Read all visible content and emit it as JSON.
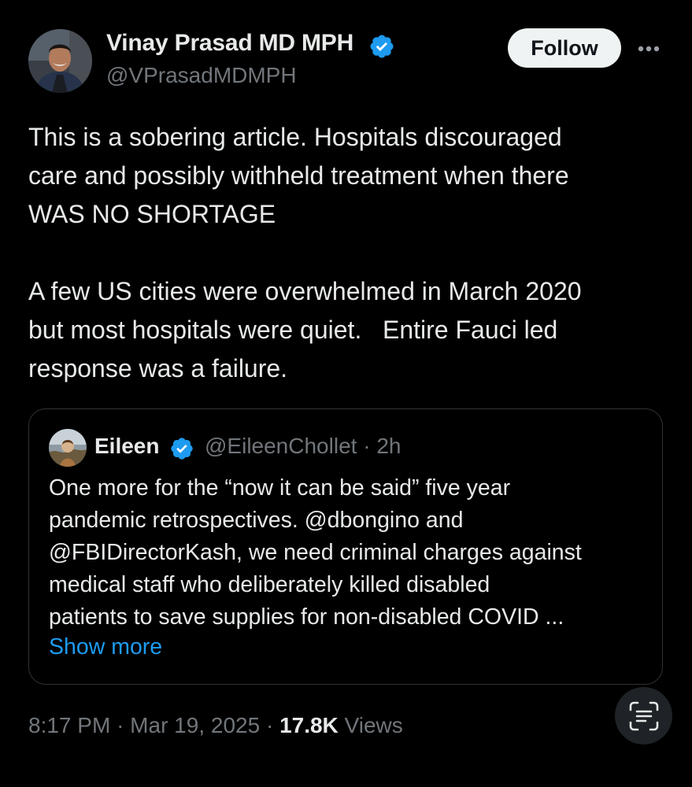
{
  "author": {
    "name": "Vinay Prasad MD MPH",
    "handle": "@VPrasadMDMPH",
    "avatar_icon": "profile-photo",
    "verified": true
  },
  "actions": {
    "follow_label": "Follow",
    "more_icon": "more-horizontal-icon"
  },
  "tweet": {
    "text": "This is a sobering article. Hospitals discouraged\ncare and possibly withheld treatment when there\nWAS NO SHORTAGE\n\nA few US cities were overwhelmed in March 2020\nbut most hospitals were quiet.   Entire Fauci led\nresponse was a failure.",
    "time": "8:17 PM",
    "date": "Mar 19, 2025",
    "views_count": "17.8K",
    "views_label": "Views",
    "separator": "·"
  },
  "quote": {
    "author_name": "Eileen",
    "author_handle": "@EileenChollet",
    "age": "2h",
    "verified": true,
    "text_lines": [
      "One more for the “now it can be said” five year",
      "pandemic retrospectives. @dbongino and",
      "@FBIDirectorKash, we need criminal charges against",
      "medical staff who deliberately killed disabled",
      "patients to save supplies for non-disabled COVID ..."
    ],
    "show_more_label": "Show more"
  },
  "floating": {
    "scan_icon": "text-scan-icon"
  },
  "colors": {
    "background": "#000000",
    "text_primary": "#e7e9ea",
    "text_secondary": "#71767b",
    "accent_blue": "#1d9bf0",
    "border": "#2f3336",
    "follow_bg": "#eff3f4"
  }
}
